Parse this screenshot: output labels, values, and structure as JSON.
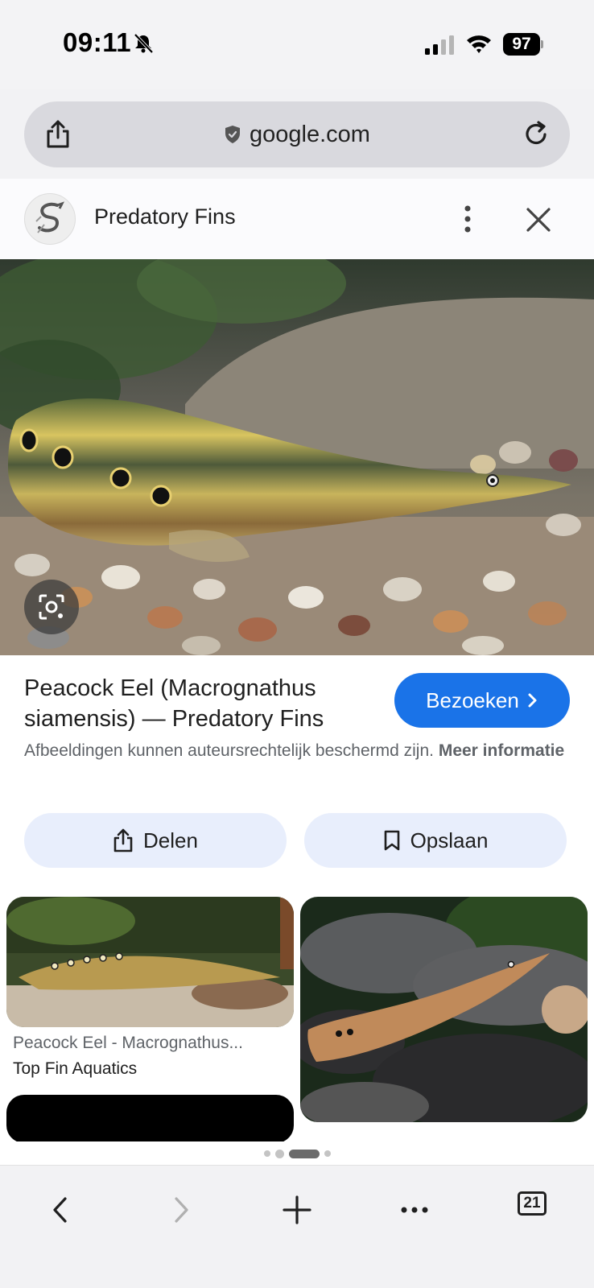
{
  "status_bar": {
    "time": "09:11",
    "battery": "97"
  },
  "browser": {
    "url": "google.com"
  },
  "sheet": {
    "site_name": "Predatory Fins",
    "result_title": "Peacock Eel (Macrognathus siamensis) — Predatory Fins",
    "visit_label": "Bezoeken",
    "copyright_text": "Afbeeldingen kunnen auteursrechtelijk beschermd zijn.",
    "more_info_label": "Meer informatie",
    "share_label": "Delen",
    "save_label": "Opslaan"
  },
  "related": [
    {
      "title": "Peacock Eel - Macrognathus...",
      "source": "Top Fin Aquatics"
    }
  ],
  "toolbar": {
    "tab_count": "21"
  }
}
